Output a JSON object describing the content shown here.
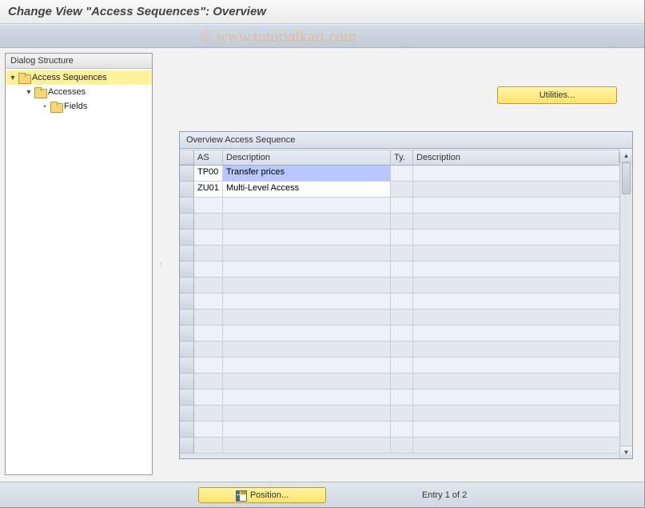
{
  "watermark": "© www.tutorialkart.com",
  "title": "Change View \"Access Sequences\": Overview",
  "tree": {
    "header": "Dialog Structure",
    "nodes": [
      {
        "label": "Access Sequences",
        "level": 1,
        "expanded": true,
        "selected": true
      },
      {
        "label": "Accesses",
        "level": 2,
        "expanded": true,
        "selected": false
      },
      {
        "label": "Fields",
        "level": 3,
        "expanded": false,
        "selected": false
      }
    ]
  },
  "buttons": {
    "utilities": "Utilities...",
    "position": "Position..."
  },
  "table": {
    "title": "Overview Access Sequence",
    "columns": {
      "as": "AS",
      "desc1": "Description",
      "ty": "Ty.",
      "desc2": "Description"
    },
    "rows": [
      {
        "as": "TP00",
        "desc1": "Transfer prices",
        "ty": "",
        "desc2": "",
        "selected": true
      },
      {
        "as": "ZU01",
        "desc1": "Multi-Level Access",
        "ty": "",
        "desc2": "",
        "selected": false
      }
    ],
    "empty_row_count": 16
  },
  "footer": {
    "entry_text": "Entry 1 of 2"
  }
}
